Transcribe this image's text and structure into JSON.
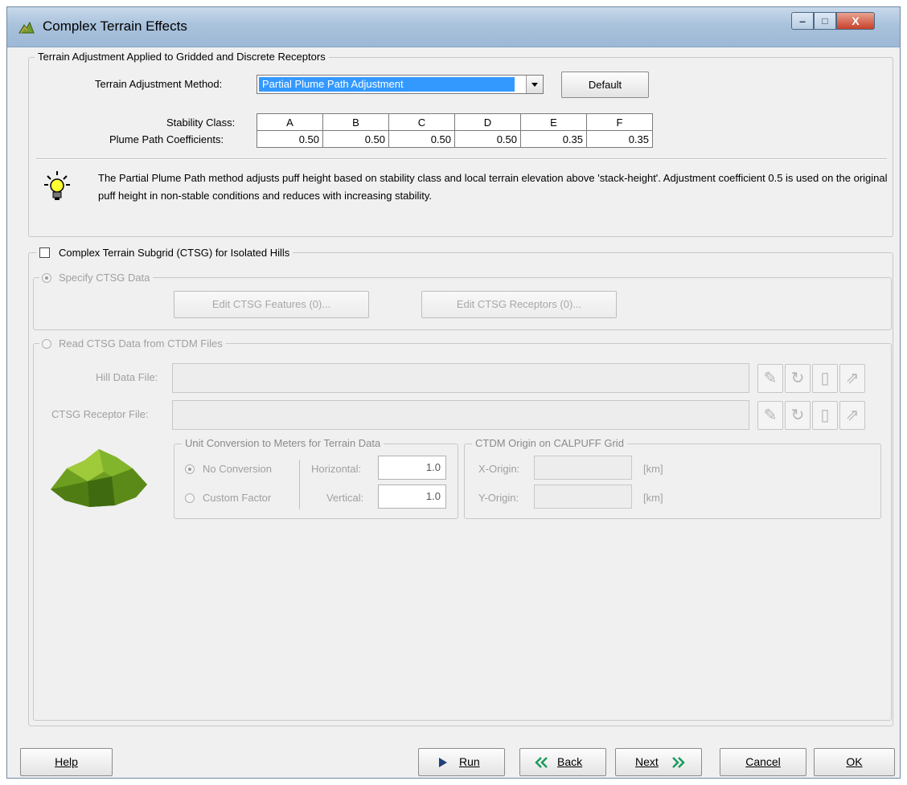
{
  "window": {
    "title": "Complex Terrain Effects",
    "min_label": "–",
    "max_label": "□",
    "close_label": "X"
  },
  "terrain": {
    "group_title": "Terrain Adjustment Applied to Gridded and Discrete Receptors",
    "method_label": "Terrain Adjustment Method:",
    "method_value": "Partial Plume Path Adjustment",
    "default_button": "Default",
    "stability_label": "Stability Class:",
    "coefficients_label": "Plume Path Coefficients:",
    "classes": [
      "A",
      "B",
      "C",
      "D",
      "E",
      "F"
    ],
    "coefficients": [
      "0.50",
      "0.50",
      "0.50",
      "0.50",
      "0.35",
      "0.35"
    ],
    "info_text": "The Partial Plume Path method adjusts puff height based on stability class and local terrain elevation above 'stack-height'. Adjustment coefficient 0.5 is used on the original puff height in non-stable conditions and reduces with increasing stability."
  },
  "ctsg": {
    "checkbox_label": "Complex Terrain Subgrid (CTSG) for Isolated Hills",
    "checked": false,
    "specify": {
      "radio_label": "Specify CTSG Data",
      "features_button": "Edit CTSG Features (0)...",
      "receptors_button": "Edit CTSG Receptors (0)..."
    },
    "read": {
      "radio_label": "Read CTSG Data from CTDM Files",
      "hill_label": "Hill Data File:",
      "hill_value": "",
      "receptor_label": "CTSG Receptor File:",
      "receptor_value": ""
    },
    "unit_conversion": {
      "title": "Unit Conversion to Meters for Terrain Data",
      "no_conversion": "No Conversion",
      "custom_factor": "Custom Factor",
      "horizontal_label": "Horizontal:",
      "horizontal_value": "1.0",
      "vertical_label": "Vertical:",
      "vertical_value": "1.0"
    },
    "origin": {
      "title": "CTDM Origin on CALPUFF Grid",
      "x_label": "X-Origin:",
      "x_value": "",
      "y_label": "Y-Origin:",
      "y_value": "",
      "unit": "[km]"
    }
  },
  "footer": {
    "help": "Help",
    "run": "Run",
    "back": "Back",
    "next": "Next",
    "cancel": "Cancel",
    "ok": "OK"
  },
  "colors": {
    "accent": "#3399ff",
    "run_arrow": "#1f3f7a",
    "nav_arrow": "#1b9a5e"
  }
}
